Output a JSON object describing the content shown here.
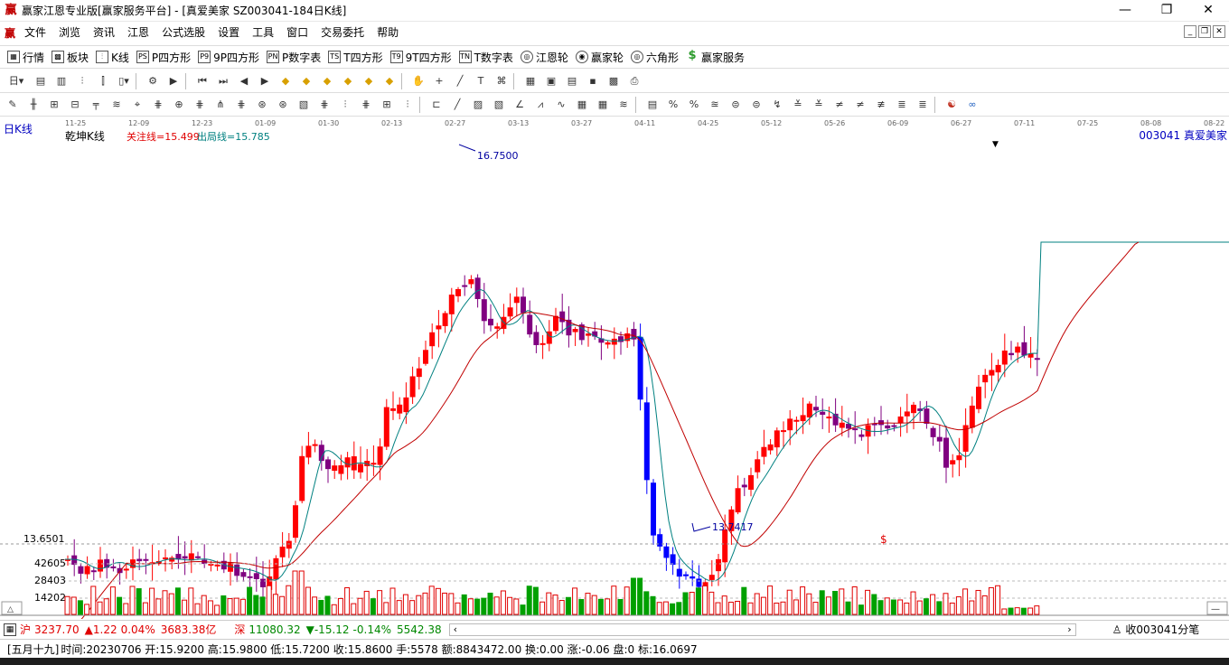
{
  "window": {
    "title": "赢家江恩专业版[赢家服务平台] - [真爱美家   SZ003041-184日K线]",
    "minimize": "—",
    "maximize": "❐",
    "close": "✕"
  },
  "menu": [
    "文件",
    "浏览",
    "资讯",
    "江恩",
    "公式选股",
    "设置",
    "工具",
    "窗口",
    "交易委托",
    "帮助"
  ],
  "toolbar1": [
    {
      "icon": "▦",
      "label": "行情"
    },
    {
      "icon": "▩",
      "label": "板块"
    },
    {
      "icon": "⫶",
      "label": "K线"
    },
    {
      "icon": "PS",
      "label": "P四方形"
    },
    {
      "icon": "P9",
      "label": "9P四方形"
    },
    {
      "icon": "PN",
      "label": "P数字表"
    },
    {
      "icon": "TS",
      "label": "T四方形"
    },
    {
      "icon": "T9",
      "label": "9T四方形"
    },
    {
      "icon": "TN",
      "label": "T数字表"
    },
    {
      "icon": "◎",
      "label": "江恩轮"
    },
    {
      "icon": "◉",
      "label": "赢家轮"
    },
    {
      "icon": "◎",
      "label": "六角形"
    },
    {
      "icon": "$",
      "label": "赢家服务"
    }
  ],
  "chart": {
    "period_label": "日K线",
    "indicator_label": "乾坤K线",
    "focus_line": "关注线=15.499",
    "exit_line": "出局线=15.785",
    "stock_label": "003041  真爱美家",
    "date_ticks": [
      "11-25",
      "12-09",
      "12-23",
      "01-09",
      "01-30",
      "02-13",
      "02-27",
      "03-13",
      "03-27",
      "04-11",
      "04-25",
      "05-12",
      "05-26",
      "06-09",
      "06-27",
      "07-11",
      "07-25",
      "08-08",
      "08-22"
    ],
    "high_label": "16.7500",
    "low_label": "13.7417",
    "price_axis_label": "13.6501",
    "dollar_mark": "$",
    "volume_axis": [
      "42605",
      "28403",
      "14202"
    ]
  },
  "chart_data": {
    "type": "candlestick",
    "price_high": 16.75,
    "price_low": 13.7417,
    "focus_line": 15.499,
    "exit_line": 15.785
  },
  "status": {
    "sh_index": "3237.70",
    "sh_change": "▲1.22",
    "sh_pct": "0.04%",
    "sh_amount": "3683.38亿",
    "sz_index": "11080.32",
    "sz_change": "▼-15.12",
    "sz_pct": "-0.14%",
    "sz_amount": "5542.38",
    "right_label": "收003041分笔"
  },
  "info": {
    "lunar": "[五月十九]",
    "text": "时间:20230706 开:15.9200 高:15.9800 低:15.7200 收:15.8600 手:5578 额:8843472.00 换:0.00 涨:-0.06 盘:0 标:16.0697"
  }
}
